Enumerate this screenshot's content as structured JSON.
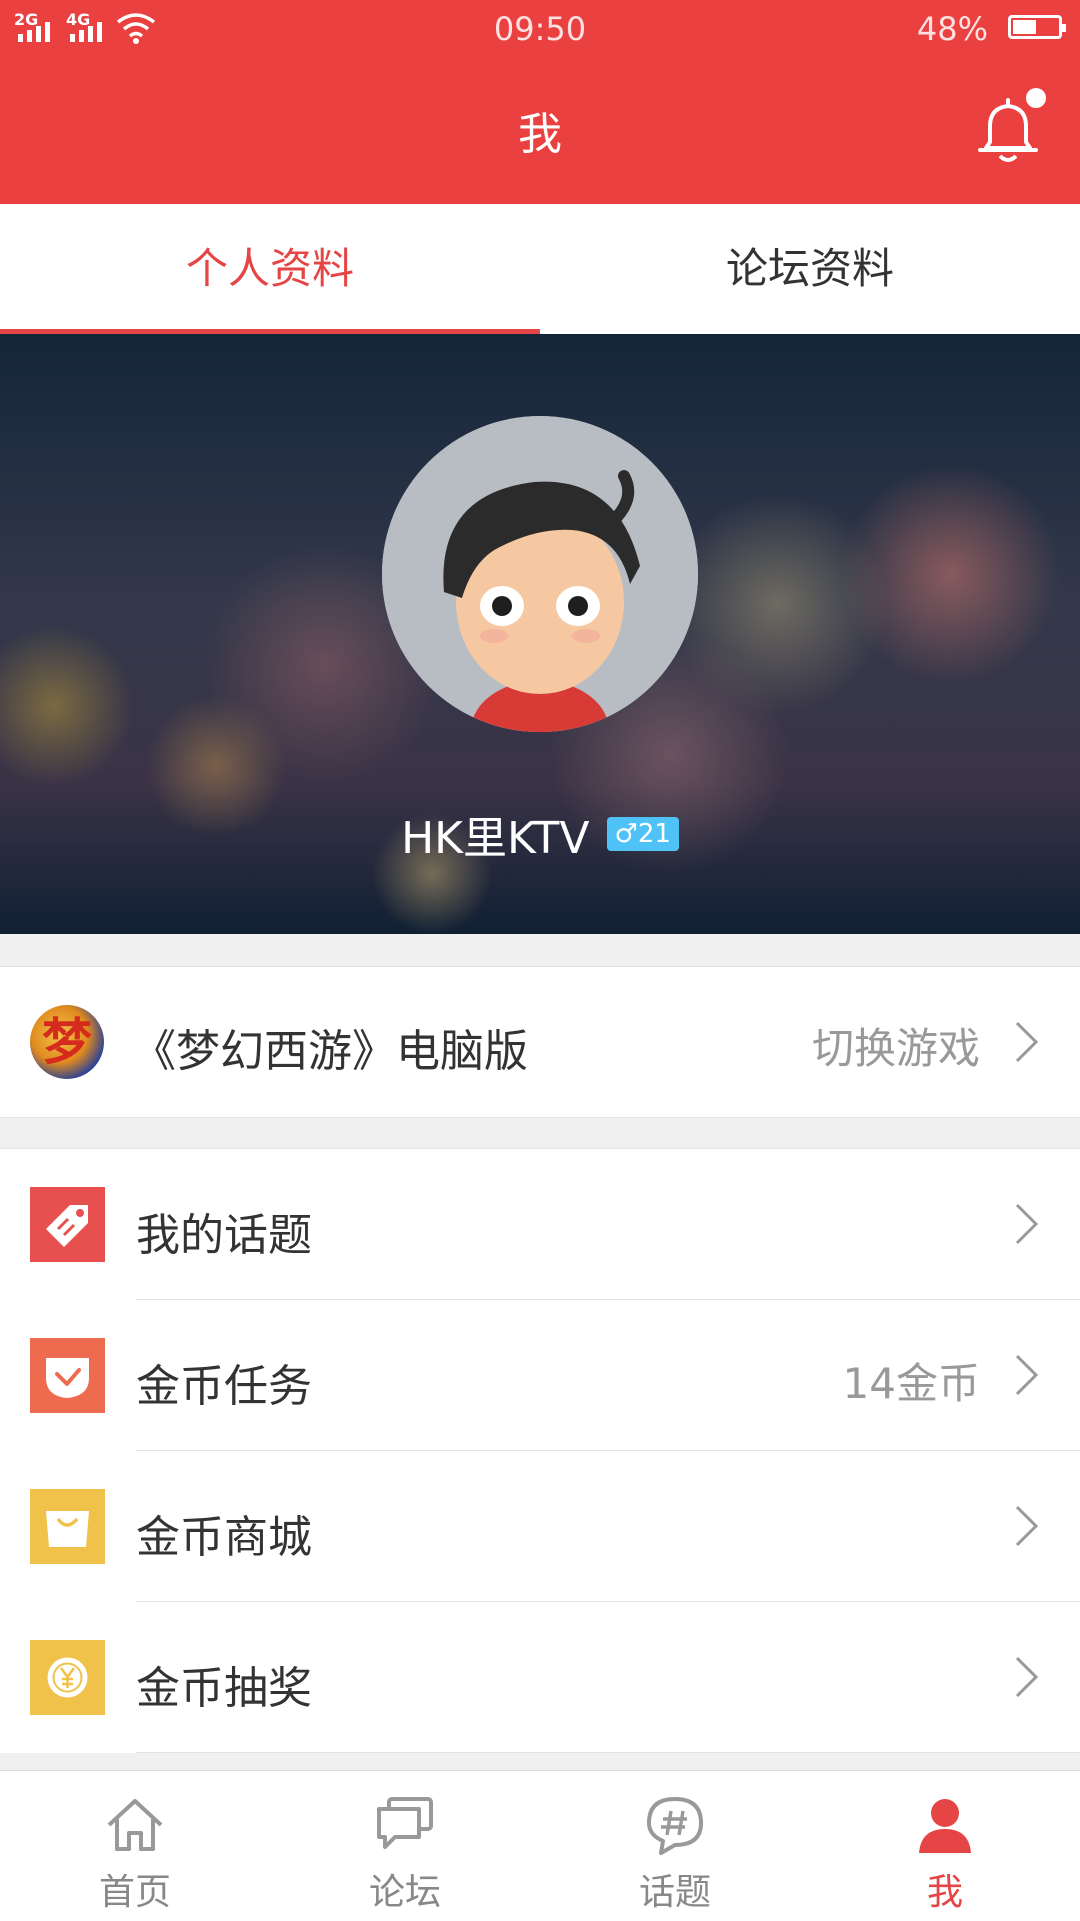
{
  "status_bar": {
    "signal_1": "2G",
    "signal_2": "4G",
    "time": "09:50",
    "battery_percent": "48%",
    "battery_level": 0.48
  },
  "header": {
    "title": "我",
    "notification_icon": "bell-icon",
    "has_unread": true
  },
  "tabs": [
    {
      "label": "个人资料",
      "active": true
    },
    {
      "label": "论坛资料",
      "active": false
    }
  ],
  "profile": {
    "username": "HK里KTV",
    "gender_symbol": "♂",
    "level": "21",
    "avatar_icon": "cartoon-avatar"
  },
  "game": {
    "logo_char": "梦",
    "title": "《梦幻西游》电脑版",
    "switch_label": "切换游戏"
  },
  "menu": [
    {
      "label": "我的话题",
      "value": "",
      "icon": "tag-icon",
      "color": "#e84f4f"
    },
    {
      "label": "金币任务",
      "value": "14金币",
      "icon": "check-pocket-icon",
      "color": "#ef6b4f"
    },
    {
      "label": "金币商城",
      "value": "",
      "icon": "shopping-bag-icon",
      "color": "#f0c24a"
    },
    {
      "label": "金币抽奖",
      "value": "",
      "icon": "yen-coin-icon",
      "color": "#f0c24a"
    }
  ],
  "tabbar": [
    {
      "label": "首页",
      "icon": "home-icon",
      "active": false
    },
    {
      "label": "论坛",
      "icon": "chat-bubble-icon",
      "active": false
    },
    {
      "label": "话题",
      "icon": "hashtag-bubble-icon",
      "active": false
    },
    {
      "label": "我",
      "icon": "person-icon",
      "active": true
    }
  ],
  "colors": {
    "primary": "#ea4040",
    "accent_text": "#e64545",
    "badge": "#4fc3f7"
  }
}
